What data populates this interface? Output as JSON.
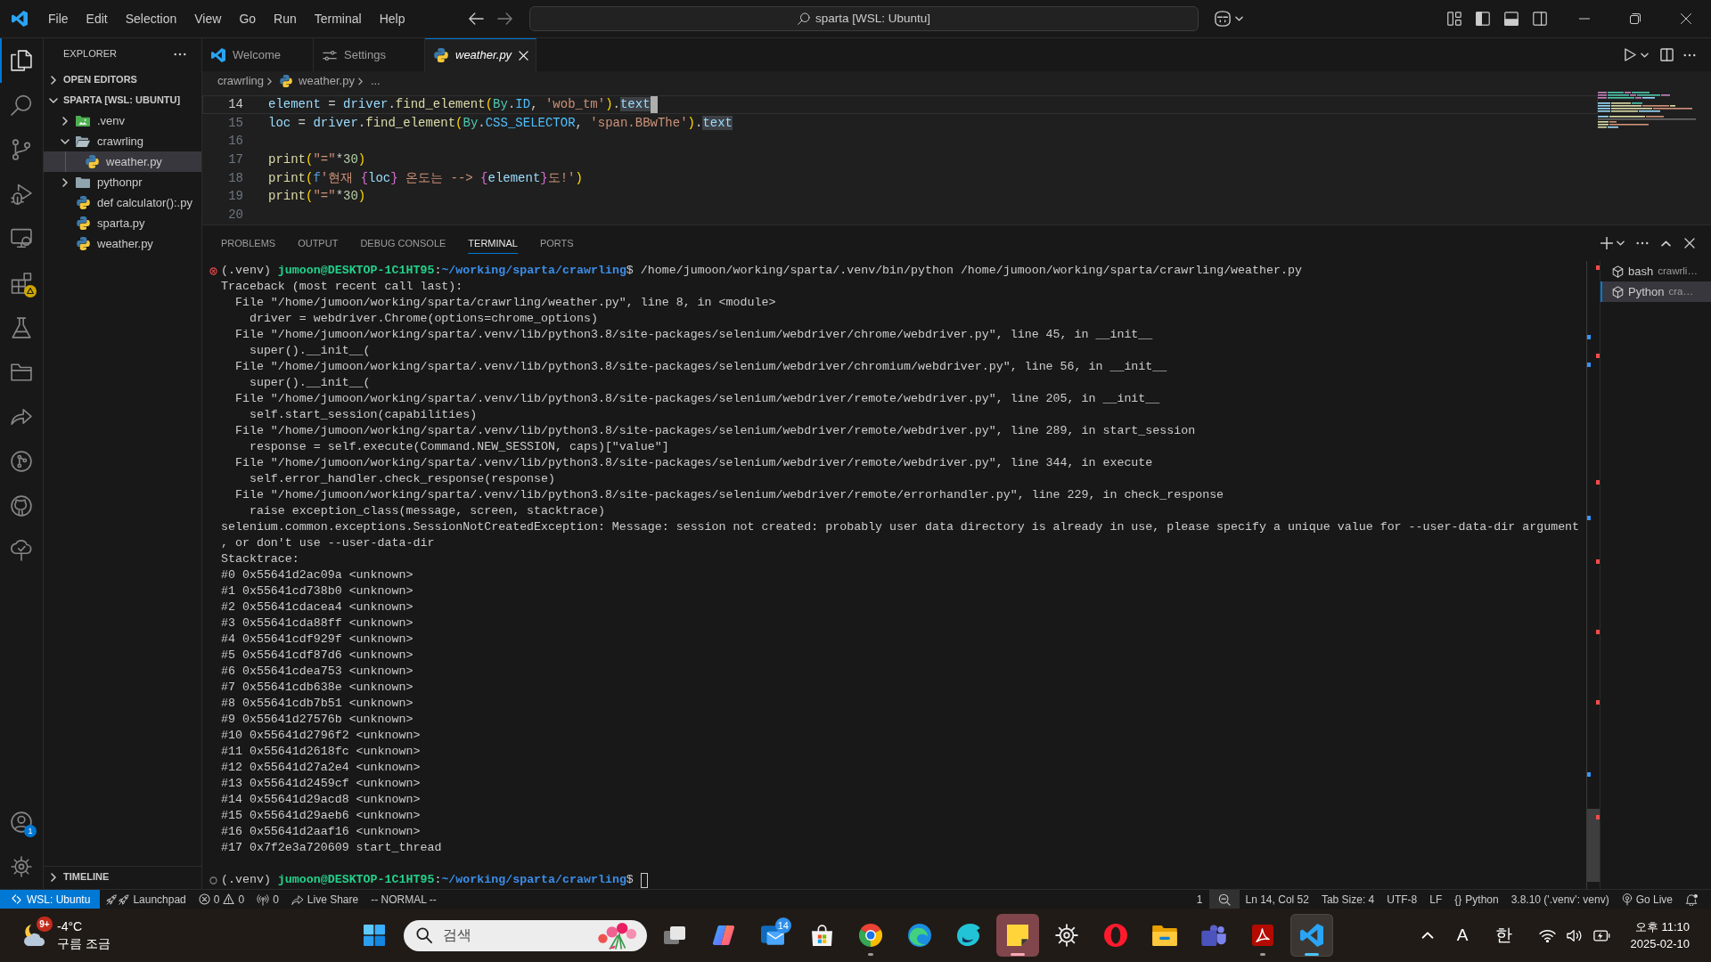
{
  "title_bar": {
    "menu": [
      "File",
      "Edit",
      "Selection",
      "View",
      "Go",
      "Run",
      "Terminal",
      "Help"
    ],
    "command_center": "sparta [WSL: Ubuntu]"
  },
  "activity_bar": {
    "items": [
      {
        "kind": "explorer",
        "selected": true,
        "warning": false
      },
      {
        "kind": "search",
        "selected": false,
        "warning": false
      },
      {
        "kind": "source-control",
        "selected": false,
        "warning": false
      },
      {
        "kind": "run-debug",
        "selected": false,
        "warning": false
      },
      {
        "kind": "remote-explorer",
        "selected": false,
        "warning": false
      },
      {
        "kind": "extensions",
        "selected": false,
        "warning": true
      },
      {
        "kind": "testing",
        "selected": false,
        "warning": false
      },
      {
        "kind": "project-manager",
        "selected": false,
        "warning": false
      },
      {
        "kind": "live-share",
        "selected": false,
        "warning": false
      },
      {
        "kind": "git-graph",
        "selected": false,
        "warning": false
      },
      {
        "kind": "github",
        "selected": false,
        "warning": false
      },
      {
        "kind": "tree-check",
        "selected": false,
        "warning": false
      }
    ],
    "accounts_badge": "1"
  },
  "sidebar": {
    "title": "EXPLORER",
    "sections": [
      {
        "label": "OPEN EDITORS",
        "expanded": false
      },
      {
        "label": "SPARTA [WSL: UBUNTU]",
        "expanded": true,
        "children": [
          {
            "label": ".venv",
            "kind": "venv-folder",
            "expanded": false,
            "selected": false
          },
          {
            "label": "crawrling",
            "kind": "folder",
            "expanded": true,
            "selected": false,
            "children": [
              {
                "label": "weather.py",
                "kind": "python",
                "selected": true
              }
            ]
          },
          {
            "label": "pythonpr",
            "kind": "folder",
            "expanded": false,
            "selected": false
          },
          {
            "label": "def calculator():.py",
            "kind": "python",
            "selected": false
          },
          {
            "label": "sparta.py",
            "kind": "python",
            "selected": false
          },
          {
            "label": "weather.py",
            "kind": "python",
            "selected": false
          }
        ]
      }
    ],
    "timeline": {
      "label": "TIMELINE",
      "expanded": false
    }
  },
  "editor": {
    "tabs": [
      {
        "label": "Welcome",
        "kind": "welcome",
        "selected": false,
        "preview": false
      },
      {
        "label": "Settings",
        "kind": "settings",
        "selected": false,
        "preview": false
      },
      {
        "label": "weather.py",
        "kind": "python",
        "selected": true,
        "preview": true
      }
    ],
    "breadcrumb": [
      {
        "label": "crawrling",
        "kind": "folder"
      },
      {
        "label": "weather.py",
        "kind": "python"
      },
      {
        "label": "...",
        "kind": "more"
      }
    ],
    "lines": [
      {
        "number": "14",
        "cursor": true,
        "tokens": [
          {
            "text": "element",
            "kind": "variable"
          },
          {
            "text": " = ",
            "kind": "operator"
          },
          {
            "text": "driver",
            "kind": "variable"
          },
          {
            "text": ".",
            "kind": "operator"
          },
          {
            "text": "find_element",
            "kind": "function"
          },
          {
            "text": "(",
            "kind": "bracket"
          },
          {
            "text": "By",
            "kind": "class"
          },
          {
            "text": ".",
            "kind": "operator"
          },
          {
            "text": "ID",
            "kind": "constant"
          },
          {
            "text": ", ",
            "kind": "operator"
          },
          {
            "text": "'wob_tm'",
            "kind": "string"
          },
          {
            "text": ")",
            "kind": "bracket"
          },
          {
            "text": ".",
            "kind": "operator"
          },
          {
            "text": "text",
            "kind": "occurrence"
          }
        ]
      },
      {
        "number": "15",
        "cursor": false,
        "tokens": [
          {
            "text": "loc",
            "kind": "variable"
          },
          {
            "text": " = ",
            "kind": "operator"
          },
          {
            "text": "driver",
            "kind": "variable"
          },
          {
            "text": ".",
            "kind": "operator"
          },
          {
            "text": "find_element",
            "kind": "function"
          },
          {
            "text": "(",
            "kind": "bracket"
          },
          {
            "text": "By",
            "kind": "class"
          },
          {
            "text": ".",
            "kind": "operator"
          },
          {
            "text": "CSS_SELECTOR",
            "kind": "constant"
          },
          {
            "text": ", ",
            "kind": "operator"
          },
          {
            "text": "'span.BBwThe'",
            "kind": "string"
          },
          {
            "text": ")",
            "kind": "bracket"
          },
          {
            "text": ".",
            "kind": "operator"
          },
          {
            "text": "text",
            "kind": "occurrence"
          }
        ]
      },
      {
        "number": "16",
        "cursor": false
      },
      {
        "number": "17",
        "cursor": false,
        "tokens": [
          {
            "text": "print",
            "kind": "function"
          },
          {
            "text": "(",
            "kind": "bracket"
          },
          {
            "text": "\"=\"",
            "kind": "string"
          },
          {
            "text": "*",
            "kind": "operator"
          },
          {
            "text": "30",
            "kind": "number"
          },
          {
            "text": ")",
            "kind": "bracket"
          }
        ]
      },
      {
        "number": "18",
        "cursor": false,
        "tokens": [
          {
            "text": "print",
            "kind": "function"
          },
          {
            "text": "(",
            "kind": "bracket"
          },
          {
            "text": "f",
            "kind": "prefix"
          },
          {
            "text": "'현재 ",
            "kind": "string"
          },
          {
            "text": "{",
            "kind": "brace"
          },
          {
            "text": "loc",
            "kind": "variable"
          },
          {
            "text": "}",
            "kind": "brace"
          },
          {
            "text": " 온도는 --> ",
            "kind": "string"
          },
          {
            "text": "{",
            "kind": "brace"
          },
          {
            "text": "element",
            "kind": "variable"
          },
          {
            "text": "}",
            "kind": "brace"
          },
          {
            "text": "도!'",
            "kind": "string"
          },
          {
            "text": ")",
            "kind": "bracket"
          }
        ]
      },
      {
        "number": "19",
        "cursor": false,
        "tokens": [
          {
            "text": "print",
            "kind": "function"
          },
          {
            "text": "(",
            "kind": "bracket"
          },
          {
            "text": "\"=\"",
            "kind": "string"
          },
          {
            "text": "*",
            "kind": "operator"
          },
          {
            "text": "30",
            "kind": "number"
          },
          {
            "text": ")",
            "kind": "bracket"
          }
        ]
      },
      {
        "number": "20",
        "cursor": false
      }
    ]
  },
  "panel": {
    "tabs": [
      {
        "label": "PROBLEMS",
        "selected": false
      },
      {
        "label": "OUTPUT",
        "selected": false
      },
      {
        "label": "DEBUG CONSOLE",
        "selected": false
      },
      {
        "label": "TERMINAL",
        "selected": true
      },
      {
        "label": "PORTS",
        "selected": false
      }
    ],
    "terminal": {
      "lines": [
        {
          "kind": "prompt",
          "failed": true,
          "cursor": false,
          "segments": [
            {
              "text": "(.venv) ",
              "kind": "plain"
            },
            {
              "text": "jumoon@DESKTOP-1C1HT95",
              "kind": "user"
            },
            {
              "text": ":",
              "kind": "plain"
            },
            {
              "text": "~/working/sparta/crawrling",
              "kind": "path"
            },
            {
              "text": "$ /home/jumoon/working/sparta/.venv/bin/python /home/jumoon/working/sparta/crawrling/weather.py",
              "kind": "plain"
            }
          ]
        },
        {
          "kind": "output",
          "text": "Traceback (most recent call last):"
        },
        {
          "kind": "output",
          "text": "  File \"/home/jumoon/working/sparta/crawrling/weather.py\", line 8, in <module>"
        },
        {
          "kind": "output",
          "text": "    driver = webdriver.Chrome(options=chrome_options)"
        },
        {
          "kind": "output",
          "text": "  File \"/home/jumoon/working/sparta/.venv/lib/python3.8/site-packages/selenium/webdriver/chrome/webdriver.py\", line 45, in __init__"
        },
        {
          "kind": "output",
          "text": "    super().__init__("
        },
        {
          "kind": "output",
          "text": "  File \"/home/jumoon/working/sparta/.venv/lib/python3.8/site-packages/selenium/webdriver/chromium/webdriver.py\", line 56, in __init__"
        },
        {
          "kind": "output",
          "text": "    super().__init__("
        },
        {
          "kind": "output",
          "text": "  File \"/home/jumoon/working/sparta/.venv/lib/python3.8/site-packages/selenium/webdriver/remote/webdriver.py\", line 205, in __init__"
        },
        {
          "kind": "output",
          "text": "    self.start_session(capabilities)"
        },
        {
          "kind": "output",
          "text": "  File \"/home/jumoon/working/sparta/.venv/lib/python3.8/site-packages/selenium/webdriver/remote/webdriver.py\", line 289, in start_session"
        },
        {
          "kind": "output",
          "text": "    response = self.execute(Command.NEW_SESSION, caps)[\"value\"]"
        },
        {
          "kind": "output",
          "text": "  File \"/home/jumoon/working/sparta/.venv/lib/python3.8/site-packages/selenium/webdriver/remote/webdriver.py\", line 344, in execute"
        },
        {
          "kind": "output",
          "text": "    self.error_handler.check_response(response)"
        },
        {
          "kind": "output",
          "text": "  File \"/home/jumoon/working/sparta/.venv/lib/python3.8/site-packages/selenium/webdriver/remote/errorhandler.py\", line 229, in check_response"
        },
        {
          "kind": "output",
          "text": "    raise exception_class(message, screen, stacktrace)"
        },
        {
          "kind": "output",
          "text": "selenium.common.exceptions.SessionNotCreatedException: Message: session not created: probably user data directory is already in use, please specify a unique value for --user-data-dir argument"
        },
        {
          "kind": "output",
          "text": ", or don't use --user-data-dir"
        },
        {
          "kind": "output",
          "text": "Stacktrace:"
        },
        {
          "kind": "output",
          "text": "#0 0x55641d2ac09a <unknown>"
        },
        {
          "kind": "output",
          "text": "#1 0x55641cd738b0 <unknown>"
        },
        {
          "kind": "output",
          "text": "#2 0x55641cdacea4 <unknown>"
        },
        {
          "kind": "output",
          "text": "#3 0x55641cda88ff <unknown>"
        },
        {
          "kind": "output",
          "text": "#4 0x55641cdf929f <unknown>"
        },
        {
          "kind": "output",
          "text": "#5 0x55641cdf87d6 <unknown>"
        },
        {
          "kind": "output",
          "text": "#6 0x55641cdea753 <unknown>"
        },
        {
          "kind": "output",
          "text": "#7 0x55641cdb638e <unknown>"
        },
        {
          "kind": "output",
          "text": "#8 0x55641cdb7b51 <unknown>"
        },
        {
          "kind": "output",
          "text": "#9 0x55641d27576b <unknown>"
        },
        {
          "kind": "output",
          "text": "#10 0x55641d2796f2 <unknown>"
        },
        {
          "kind": "output",
          "text": "#11 0x55641d2618fc <unknown>"
        },
        {
          "kind": "output",
          "text": "#12 0x55641d27a2e4 <unknown>"
        },
        {
          "kind": "output",
          "text": "#13 0x55641d2459cf <unknown>"
        },
        {
          "kind": "output",
          "text": "#14 0x55641d29acd8 <unknown>"
        },
        {
          "kind": "output",
          "text": "#15 0x55641d29aeb6 <unknown>"
        },
        {
          "kind": "output",
          "text": "#16 0x55641d2aaf16 <unknown>"
        },
        {
          "kind": "output",
          "text": "#17 0x7f2e3a720609 start_thread"
        },
        {
          "kind": "prompt",
          "failed": false,
          "cursor": true,
          "segments": [
            {
              "text": "(.venv) ",
              "kind": "plain"
            },
            {
              "text": "jumoon@DESKTOP-1C1HT95",
              "kind": "user"
            },
            {
              "text": ":",
              "kind": "plain"
            },
            {
              "text": "~/working/sparta/crawrling",
              "kind": "path"
            },
            {
              "text": "$ ",
              "kind": "plain"
            }
          ]
        }
      ]
    },
    "sessions": [
      {
        "name": "bash",
        "detail": "crawrli…",
        "selected": false
      },
      {
        "name": "Python",
        "detail": "cra…",
        "selected": true
      }
    ]
  },
  "status_bar": {
    "left": [
      {
        "kind": "remote",
        "label": "WSL: Ubuntu"
      },
      {
        "kind": "launchpad",
        "label": "Launchpad"
      },
      {
        "kind": "problems",
        "errors": "0",
        "warnings": "0"
      },
      {
        "kind": "ports",
        "label": "0"
      },
      {
        "kind": "live-share",
        "label": "Live Share"
      },
      {
        "kind": "text",
        "label": "-- NORMAL --"
      }
    ],
    "right": [
      {
        "kind": "text",
        "label": "1"
      },
      {
        "kind": "zoom"
      },
      {
        "kind": "text",
        "label": "Ln 14, Col 52"
      },
      {
        "kind": "text",
        "label": "Tab Size: 4"
      },
      {
        "kind": "text",
        "label": "UTF-8"
      },
      {
        "kind": "text",
        "label": "LF"
      },
      {
        "kind": "language",
        "glyph": "{}",
        "label": "Python"
      },
      {
        "kind": "text",
        "label": "3.8.10 ('.venv': venv)"
      },
      {
        "kind": "go-live",
        "label": "Go Live"
      },
      {
        "kind": "notifications"
      }
    ]
  },
  "taskbar": {
    "weather": {
      "badge": "9+",
      "temperature": "-4°C",
      "condition": "구름 조금"
    },
    "search": {
      "placeholder": "검색"
    },
    "apps": [
      {
        "kind": "task-view",
        "running": false,
        "focused": false,
        "flashing": false
      },
      {
        "kind": "copilot",
        "running": false,
        "focused": false,
        "flashing": false
      },
      {
        "kind": "outlook",
        "running": false,
        "focused": false,
        "flashing": false,
        "badge": "14"
      },
      {
        "kind": "store",
        "running": false,
        "focused": false,
        "flashing": false
      },
      {
        "kind": "chrome",
        "running": true,
        "focused": false,
        "flashing": false
      },
      {
        "kind": "edge",
        "running": false,
        "focused": false,
        "flashing": false
      },
      {
        "kind": "whale",
        "running": false,
        "focused": false,
        "flashing": false
      },
      {
        "kind": "sticky-notes",
        "running": true,
        "focused": false,
        "flashing": true
      },
      {
        "kind": "settings",
        "running": false,
        "focused": false,
        "flashing": false
      },
      {
        "kind": "opera",
        "running": false,
        "focused": false,
        "flashing": false
      },
      {
        "kind": "file-explorer",
        "running": false,
        "focused": false,
        "flashing": false
      },
      {
        "kind": "teams",
        "running": false,
        "focused": false,
        "flashing": false
      },
      {
        "kind": "acrobat",
        "running": true,
        "focused": false,
        "flashing": false
      },
      {
        "kind": "vscode",
        "running": true,
        "focused": true,
        "flashing": false
      }
    ],
    "tray": {
      "ime": [
        "A",
        "한"
      ],
      "time": "오후 11:10",
      "date": "2025-02-10"
    }
  }
}
